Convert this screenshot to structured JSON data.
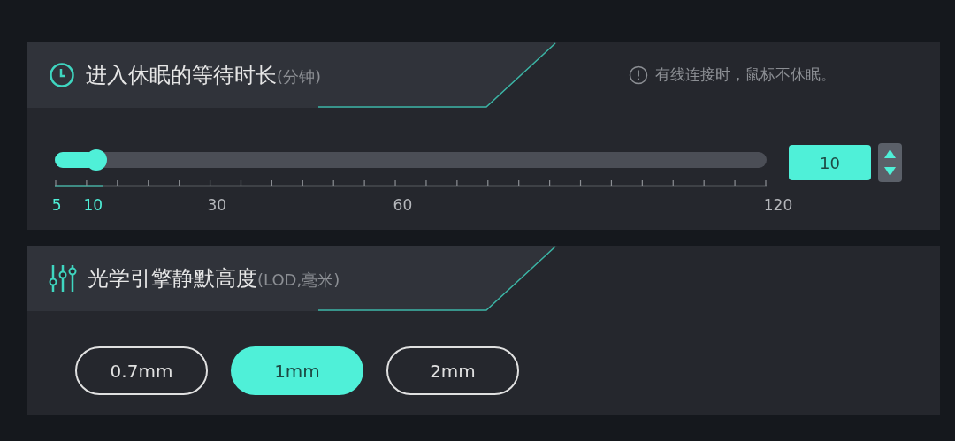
{
  "sleep_section": {
    "title": "进入休眠的等待时长",
    "unit": "(分钟)",
    "hint": "有线连接时，鼠标不休眠。",
    "slider": {
      "level": 0.043,
      "value": "10",
      "labels": [
        {
          "text": "5",
          "active": true
        },
        {
          "text": "10",
          "active": true
        },
        {
          "text": "30",
          "active": false
        },
        {
          "text": "60",
          "active": false
        },
        {
          "text": "120",
          "active": false
        }
      ]
    }
  },
  "lod_section": {
    "title": "光学引擎静默高度",
    "unit": "(LOD,毫米)",
    "options": [
      {
        "label": "0.7mm",
        "selected": false
      },
      {
        "label": "1mm",
        "selected": true
      },
      {
        "label": "2mm",
        "selected": false
      }
    ]
  }
}
